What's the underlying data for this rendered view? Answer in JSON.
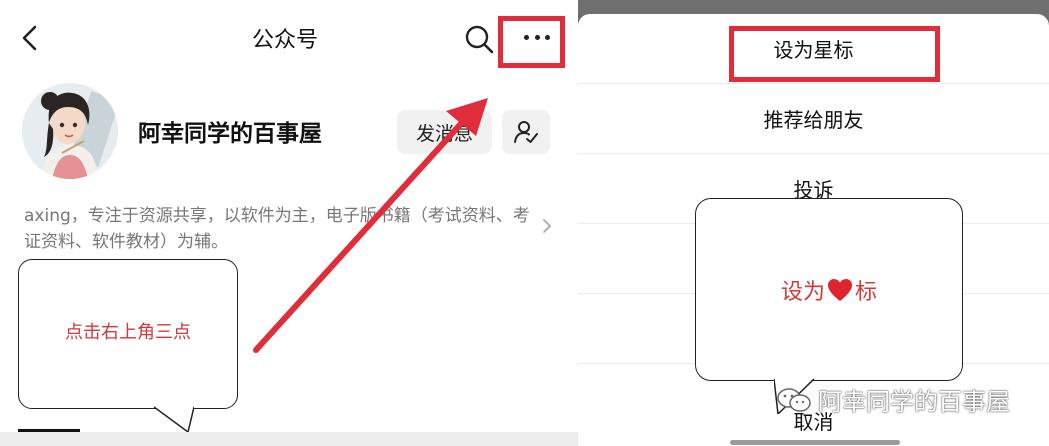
{
  "left_panel": {
    "header": {
      "title": "公众号"
    },
    "account": {
      "name": "阿幸同学的百事屋",
      "send_message_label": "发消息",
      "description": "axing，专注于资源共享，以软件为主，电子版书籍（考试资料、考证资料、软件教材）为辅。"
    },
    "annotation": {
      "text": "点击右上角三点"
    },
    "colors": {
      "highlight": "#e02d3c",
      "annotation_text": "#d23a3a"
    }
  },
  "right_panel": {
    "menu": {
      "items": [
        {
          "label": "设为星标"
        },
        {
          "label": "推荐给朋友"
        },
        {
          "label": "投诉"
        }
      ],
      "cancel_label": "取消"
    },
    "annotation": {
      "text_before": "设为",
      "icon": "heart-icon",
      "text_after": "标"
    },
    "watermark": {
      "text": "阿幸同学的百事屋",
      "icon": "wechat-icon"
    }
  }
}
